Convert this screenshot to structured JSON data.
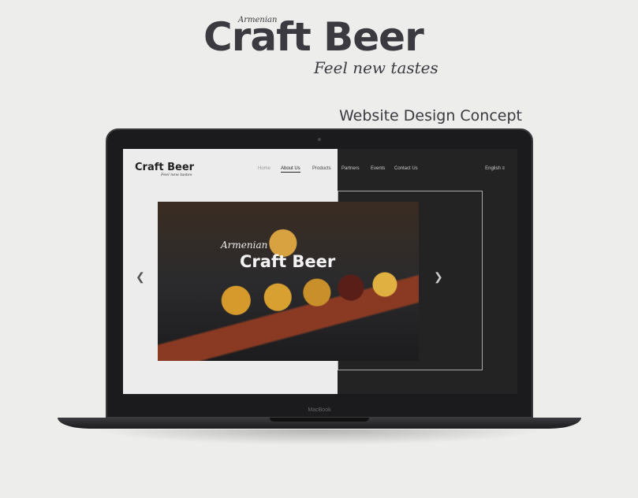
{
  "header": {
    "brand_small": "Armenian",
    "brand": "Craft Beer",
    "tagline": "Feel new tastes",
    "subtitle": "Website Design Concept"
  },
  "device": {
    "label": "MacBook"
  },
  "site": {
    "logo": "Craft Beer",
    "logo_tagline": "Feel new tastes",
    "nav": [
      "Home",
      "About Us",
      "Products",
      "Partners",
      "Events",
      "Contact Us"
    ],
    "active_nav": "About Us",
    "language": "English",
    "hero": {
      "small": "Armenian",
      "title": "Craft Beer"
    },
    "icons": {
      "prev": "chevron-left-icon",
      "next": "chevron-right-icon",
      "menu": "hamburger-icon"
    }
  }
}
